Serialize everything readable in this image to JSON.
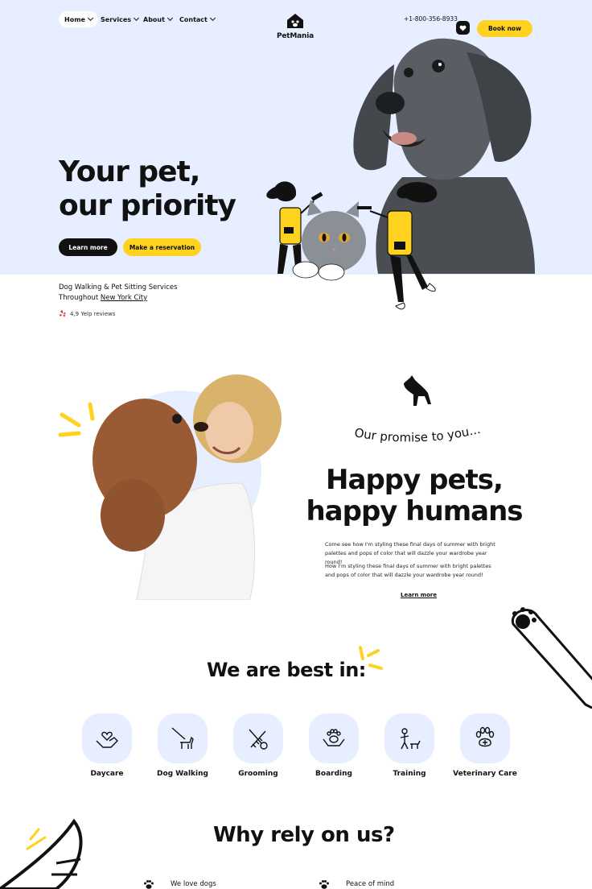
{
  "nav": {
    "items": [
      {
        "label": "Home",
        "active": true
      },
      {
        "label": "Services",
        "active": false
      },
      {
        "label": "About",
        "active": false
      },
      {
        "label": "Contact",
        "active": false
      }
    ],
    "logo_text": "PetMania",
    "phone": "+1-800-356-8933",
    "book_label": "Book now"
  },
  "hero": {
    "title_line1": "Your pet,",
    "title_line2": "our priority",
    "learn_more": "Learn more",
    "reservation": "Make a reservation",
    "sub_line1": "Dog Walking & Pet Sitting Services",
    "sub_line2_prefix": "Throughout ",
    "sub_line2_link": "New York City",
    "rating": "4,9 Yelp reviews"
  },
  "promise": {
    "kicker": "Our promise to you...",
    "title_line1": "Happy pets,",
    "title_line2": "happy humans",
    "paragraph1": "Come see how I'm styling these final days of summer with bright palettes and pops of color that will dazzle your wardrobe year round!",
    "paragraph2": "How I'm styling these final days of summer with bright palettes and pops of color that will dazzle your wardrobe year round!",
    "link": "Learn more"
  },
  "services": {
    "title": "We are best in:",
    "items": [
      {
        "label": "Daycare",
        "icon": "hands-heart-icon"
      },
      {
        "label": "Dog Walking",
        "icon": "dog-leash-icon"
      },
      {
        "label": "Grooming",
        "icon": "scissors-comb-icon"
      },
      {
        "label": "Boarding",
        "icon": "paw-hands-icon"
      },
      {
        "label": "Training",
        "icon": "person-dog-icon"
      },
      {
        "label": "Veterinary Care",
        "icon": "paw-cross-icon"
      }
    ]
  },
  "why": {
    "title": "Why rely on us?",
    "items": [
      {
        "label": "We love dogs"
      },
      {
        "label": "Peace of mind"
      }
    ]
  },
  "colors": {
    "accent_yellow": "#ffd21f",
    "hero_blue": "#e6eeff",
    "dark": "#111111"
  }
}
